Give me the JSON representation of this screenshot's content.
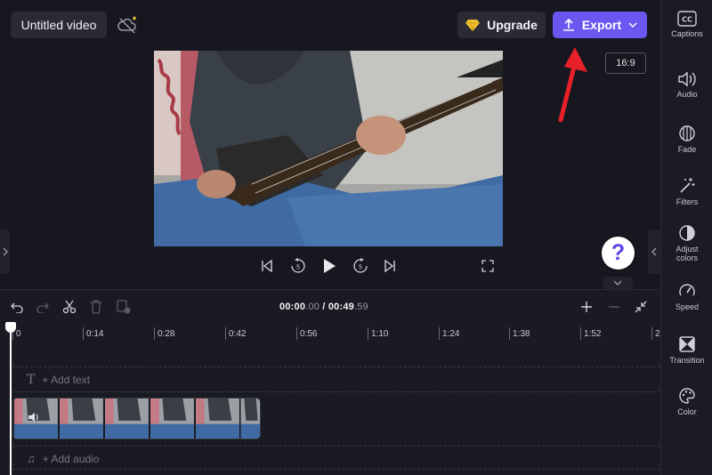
{
  "header": {
    "project_title": "Untitled video",
    "upgrade_label": "Upgrade",
    "export_label": "Export",
    "aspect_ratio": "16:9"
  },
  "sidebar": {
    "items": [
      {
        "label": "Captions",
        "icon": "captions-icon"
      },
      {
        "label": "Audio",
        "icon": "speaker-icon"
      },
      {
        "label": "Fade",
        "icon": "fade-icon"
      },
      {
        "label": "Filters",
        "icon": "magic-wand-icon"
      },
      {
        "label": "Adjust colors",
        "icon": "contrast-icon"
      },
      {
        "label": "Speed",
        "icon": "speedometer-icon"
      },
      {
        "label": "Transition",
        "icon": "transition-icon"
      },
      {
        "label": "Color",
        "icon": "palette-icon"
      }
    ]
  },
  "player": {
    "help_label": "?"
  },
  "timeline": {
    "current_time_main": "00:00",
    "current_time_frac": ".00",
    "separator": " / ",
    "total_time_main": "00:49",
    "total_time_frac": ".59",
    "ruler": [
      "0",
      "0:14",
      "0:28",
      "0:42",
      "0:56",
      "1:10",
      "1:24",
      "1:38",
      "1:52",
      "2"
    ],
    "add_text_label": "+ Add text",
    "add_audio_label": "+ Add audio"
  },
  "colors": {
    "accent": "#6a57f0",
    "annotation_arrow": "#e8202a",
    "gem": "#f2c230"
  }
}
